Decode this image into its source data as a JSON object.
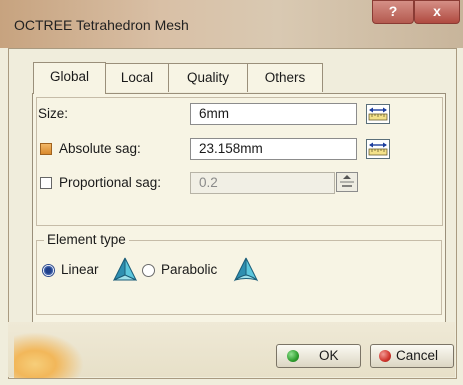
{
  "window": {
    "title": "OCTREE Tetrahedron Mesh",
    "help_label": "?",
    "close_label": "x"
  },
  "tabs": [
    {
      "label": "Global",
      "active": true
    },
    {
      "label": "Local",
      "active": false
    },
    {
      "label": "Quality",
      "active": false
    },
    {
      "label": "Others",
      "active": false
    }
  ],
  "global": {
    "size_label": "Size:",
    "size_value": "6mm",
    "absolute_sag_label": "Absolute sag:",
    "absolute_sag_checked": true,
    "absolute_sag_value": "23.158mm",
    "proportional_sag_label": "Proportional sag:",
    "proportional_sag_checked": false,
    "proportional_sag_value": "0.2"
  },
  "element_type": {
    "title": "Element type",
    "linear_label": "Linear",
    "linear_selected": true,
    "parabolic_label": "Parabolic",
    "parabolic_selected": false
  },
  "buttons": {
    "ok_label": "OK",
    "cancel_label": "Cancel"
  },
  "colors": {
    "ok_dot": "#2e9e2e",
    "cancel_dot": "#d0342c",
    "tetra_fill": "#3ab0c8"
  }
}
